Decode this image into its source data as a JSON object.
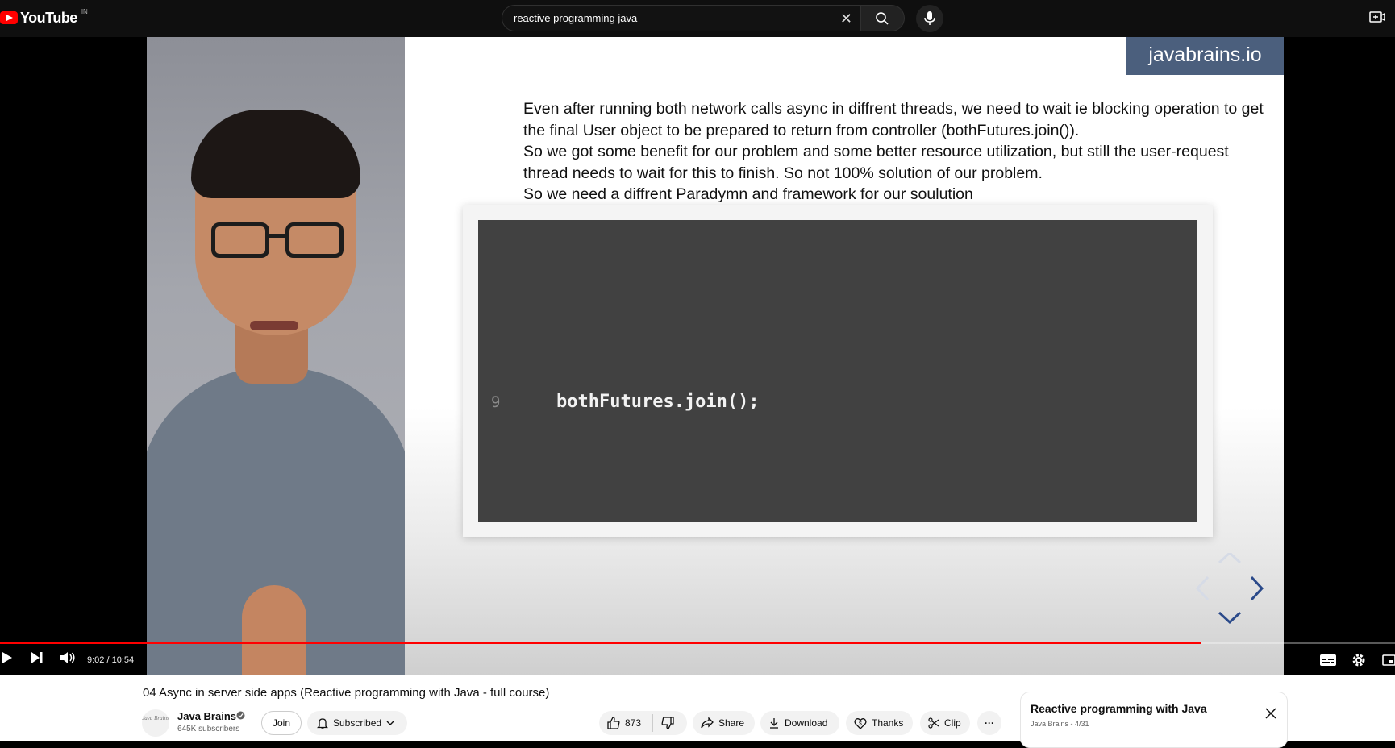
{
  "topbar": {
    "logo_text": "YouTube",
    "logo_country": "IN",
    "search_value": "reactive programming java",
    "icons": [
      "youtube-logo-icon",
      "clear-search-icon",
      "search-icon",
      "microphone-icon",
      "create-icon"
    ]
  },
  "video": {
    "watermark": "javabrains.io",
    "slide_lines": [
      "Even after running both network calls async in diffrent threads, we need to wait ie blocking operation to get the final User object to be prepared to return from controller (bothFutures.join()).",
      "So we got some benefit for our problem and some better resource utilization, but still the user-request thread needs to wait for this to finish. So not 100% solution of our problem.",
      "So we need a diffrent Paradymn and framework for our soulution"
    ],
    "code_line_number": "9",
    "code_text": "bothFutures.join();",
    "progress_fraction": 0.861,
    "time": "9:02 / 10:54",
    "icons": [
      "play-icon",
      "next-icon",
      "volume-icon",
      "subtitles-icon",
      "settings-icon",
      "miniplayer-icon"
    ]
  },
  "info": {
    "title": "04 Async in server side apps (Reactive programming with Java - full course)",
    "channel_name": "Java Brains",
    "channel_avatar_text": "Java Brains",
    "subscribers": "645K subscribers",
    "join_label": "Join",
    "subscribed_label": "Subscribed",
    "like_count": "873",
    "share_label": "Share",
    "download_label": "Download",
    "thanks_label": "Thanks",
    "clip_label": "Clip",
    "more_label": "···"
  },
  "playlist": {
    "title": "Reactive programming with Java",
    "subtitle": "Java Brains - 4/31"
  },
  "colors": {
    "accent": "#ff0000",
    "topbar_bg": "#0f0f0f",
    "watermark_bg": "#4b5f7d",
    "code_bg": "#414141"
  }
}
